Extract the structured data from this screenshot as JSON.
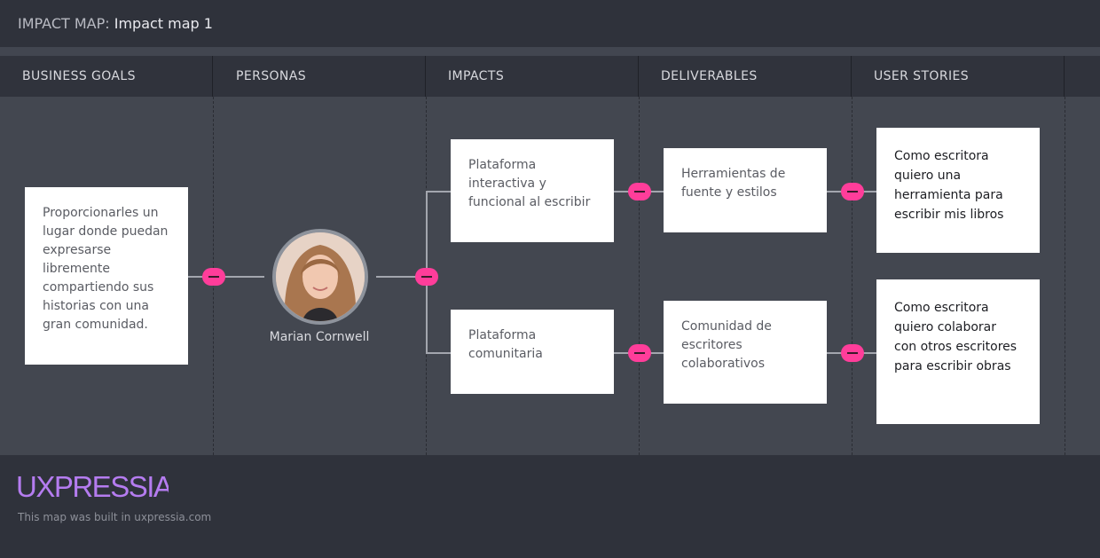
{
  "map": {
    "prefix": "IMPACT MAP:",
    "name": "Impact map 1"
  },
  "columns": [
    {
      "label": "BUSINESS GOALS"
    },
    {
      "label": "PERSONAS"
    },
    {
      "label": "IMPACTS"
    },
    {
      "label": "DELIVERABLES"
    },
    {
      "label": "USER STORIES"
    }
  ],
  "business_goal": {
    "text": "Proporcionarles un lugar donde puedan expresarse libremente compartiendo sus historias con una gran comunidad."
  },
  "persona": {
    "name": "Marian Cornwell",
    "avatar_icon": "person-photo"
  },
  "impacts": [
    {
      "text": "Plataforma interactiva y funcional al escribir"
    },
    {
      "text": "Plataforma comunitaria"
    }
  ],
  "deliverables": [
    {
      "text": "Herramientas de fuente y estilos"
    },
    {
      "text": "Comunidad de escritores colaborativos"
    }
  ],
  "user_stories": [
    {
      "text": "Como escritora quiero una herramienta para escribir mis libros"
    },
    {
      "text": "Como escritora quiero colaborar con otros escritores para escribir obras"
    }
  ],
  "footer": {
    "logo": "UXPRESSIA",
    "built_text": "This map was built in uxpressia.com"
  },
  "colors": {
    "accent": "#ff3d9a",
    "logo": "#b57cf0",
    "canvas": "#434750"
  }
}
